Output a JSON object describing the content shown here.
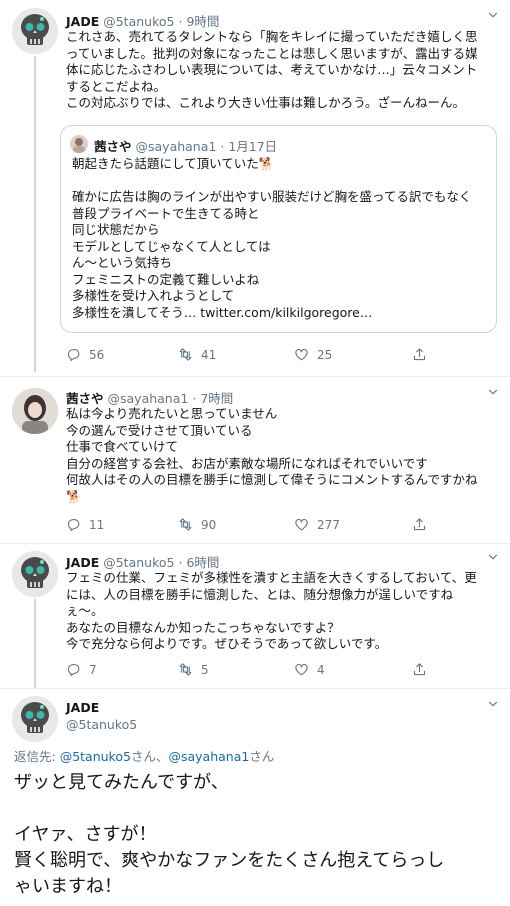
{
  "tweet1": {
    "name": "JADE",
    "handle": "@5tanuko5",
    "dot": "·",
    "time": "9時間",
    "lines": [
      "これさあ、売れてるタレントなら「胸をキレイに撮っていただき嬉しく思",
      "っていました。批判の対象になったことは悲しく思いますが、露出する媒",
      "体に応じたふさわしい表現については、考えていかなけ…」云々コメント",
      "するとこだよね。",
      "この対応ぶりでは、これより大きい仕事は難しかろう。ざーんねーん。"
    ],
    "quote": {
      "name": "茜さや",
      "handle": "@sayahana1",
      "dot": "·",
      "time": "1月17日",
      "lines": [
        "朝起きたら話題にして頂いていた🐕",
        "",
        "確かに広告は胸のラインが出やすい服装だけど胸を盛ってる訳でもなく",
        "普段プライベートで生きてる時と",
        "同じ状態だから",
        "モデルとしてじゃなくて人としては",
        "ん〜という気持ち",
        "フェミニストの定義て難しいよね",
        "多様性を受け入れようとして",
        "多様性を潰してそう…"
      ],
      "link": "twitter.com/kilkilgoregore…"
    },
    "replies": "56",
    "retweets": "41",
    "likes": "25"
  },
  "tweet2": {
    "name": "茜さや",
    "handle": "@sayahana1",
    "dot": "·",
    "time": "7時間",
    "lines": [
      "私は今より売れたいと思っていません",
      "今の選んで受けさせて頂いている",
      "仕事で食べていけて",
      "自分の経営する会社、お店が素敵な場所になればそれでいいです",
      "何故人はその人の目標を勝手に憶測して偉そうにコメントするんですかね",
      "🐕"
    ],
    "replies": "11",
    "retweets": "90",
    "likes": "277"
  },
  "tweet3": {
    "name": "JADE",
    "handle": "@5tanuko5",
    "dot": "·",
    "time": "6時間",
    "lines": [
      "フェミの仕業、フェミが多様性を潰すと主語を大きくするしておいて、更",
      "には、人の目標を勝手に憶測した、とは、随分想像力が逞しいですね",
      "ぇ〜。",
      "あなたの目標なんか知ったこっちゃないですよ？",
      "今で充分なら何よりです。ぜひそうであって欲しいです。"
    ],
    "replies": "7",
    "retweets": "5",
    "likes": "4"
  },
  "tweet4": {
    "name": "JADE",
    "handle": "@5tanuko5",
    "reply_prefix": "返信先: ",
    "reply_user1": "@5tanuko5",
    "reply_mid": "さん、",
    "reply_user2": "@sayahana1",
    "reply_suffix": "さん",
    "lines": [
      "ザッと見てみたんですが、",
      "",
      "イヤァ、さすが！",
      "賢く聡明で、爽やかなファンをたくさん抱えてらっし",
      "ゃいますね！"
    ]
  },
  "colors": {
    "secondary": "#657786",
    "link": "#1b6aa5",
    "border": "#ccd6dd",
    "divider": "#e6ecf0"
  }
}
